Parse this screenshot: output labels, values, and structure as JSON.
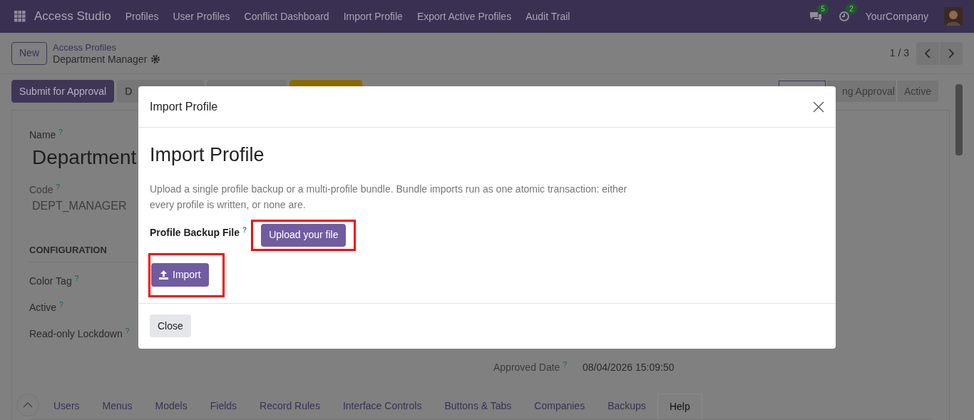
{
  "navbar": {
    "app_name": "Access Studio",
    "menu": [
      "Profiles",
      "User Profiles",
      "Conflict Dashboard",
      "Import Profile",
      "Export Active Profiles",
      "Audit Trail"
    ],
    "messages_badge": "5",
    "activities_badge": "2",
    "company": "YourCompany"
  },
  "control_panel": {
    "new_button": "New",
    "breadcrumb": "Access Profiles",
    "record_title": "Department Manager",
    "pager": "1 / 3"
  },
  "header_buttons": [
    {
      "label": "Submit for Approval",
      "kind": "primary"
    },
    {
      "label": "D",
      "kind": "secondary"
    },
    {
      "kind": "secondary"
    },
    {
      "kind": "warning"
    }
  ],
  "status_steps": [
    {
      "selected": true
    },
    {
      "label": "ng Approval",
      "selected": false
    },
    {
      "label": "Active",
      "selected": false
    }
  ],
  "form": {
    "name": {
      "label": "Name",
      "hint": "?",
      "value": "Department"
    },
    "code": {
      "label": "Code",
      "hint": "?",
      "value": "DEPT_MANAGER"
    },
    "section": "CONFIGURATION",
    "fields": [
      {
        "label": "Color Tag",
        "hint": "?"
      },
      {
        "label": "Active",
        "hint": "?"
      },
      {
        "label": "Read-only Lockdown",
        "hint": "?"
      }
    ],
    "approved_date": {
      "label": "Approved Date",
      "hint": "?",
      "value": "08/04/2026 15:09:50"
    }
  },
  "tabs": [
    {
      "label": "Users",
      "selected": false
    },
    {
      "label": "Menus",
      "selected": false
    },
    {
      "label": "Models",
      "selected": false
    },
    {
      "label": "Fields",
      "selected": false
    },
    {
      "label": "Record Rules",
      "selected": false
    },
    {
      "label": "Interface Controls",
      "selected": false
    },
    {
      "label": "Buttons & Tabs",
      "selected": false
    },
    {
      "label": "Companies",
      "selected": false
    },
    {
      "label": "Backups",
      "selected": false
    },
    {
      "label": "Help",
      "selected": true
    }
  ],
  "dialog": {
    "title": "Import Profile",
    "heading": "Import Profile",
    "description": "Upload a single profile backup or a multi-profile bundle. Bundle imports run as one atomic transaction: either every profile is written, or none are.",
    "file_label": "Profile Backup File",
    "file_hint": "?",
    "upload_button": "Upload your file",
    "import_button": "Import",
    "close_button": "Close"
  }
}
